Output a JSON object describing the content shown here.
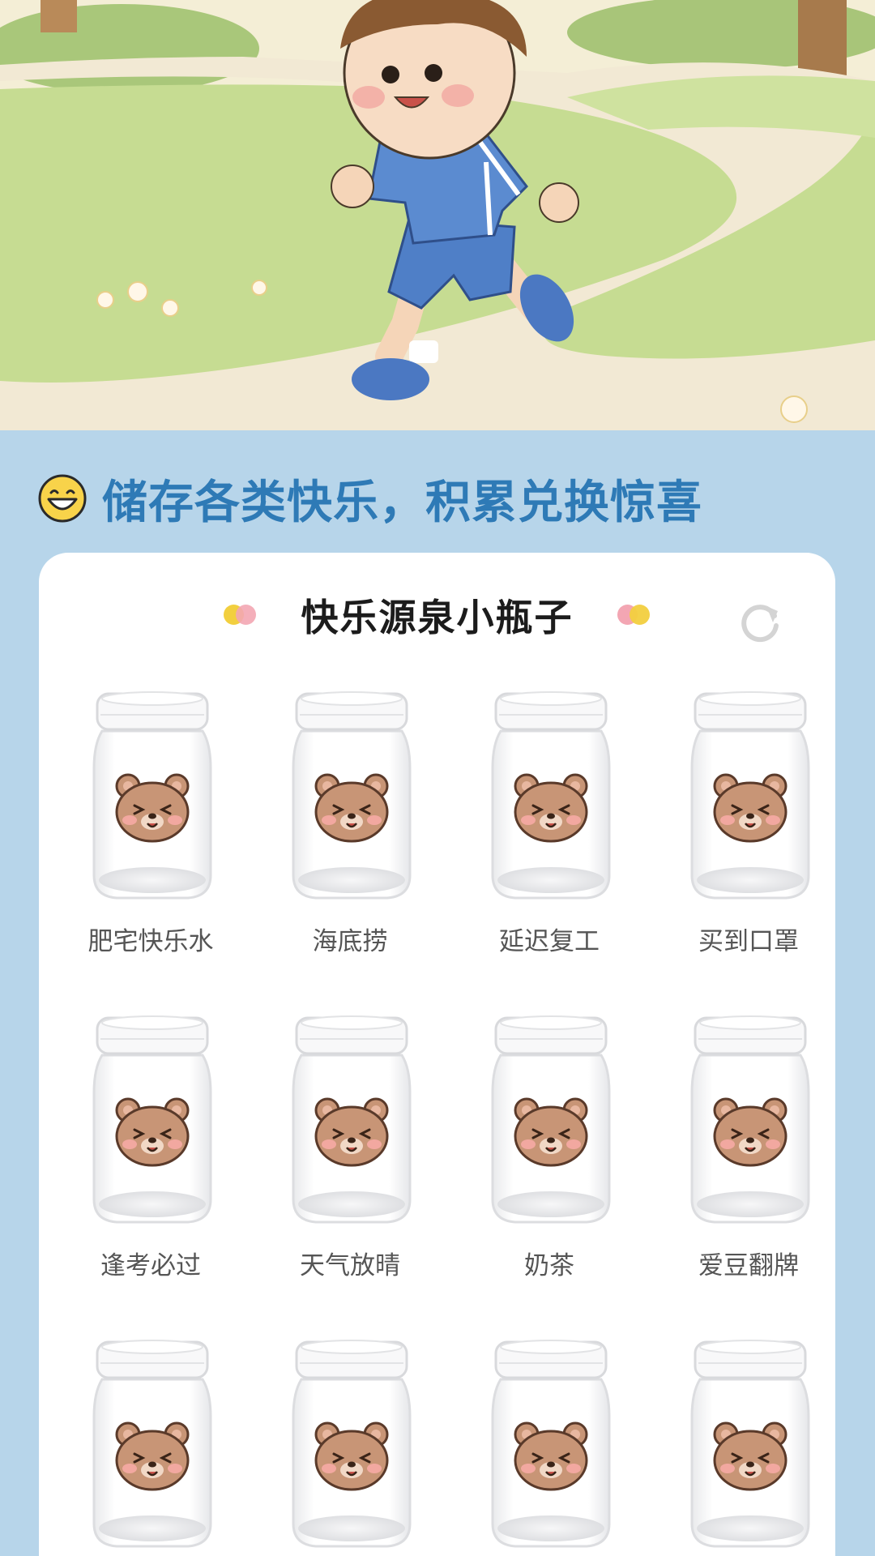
{
  "headline": {
    "icon": "grinning-face-icon",
    "text": "储存各类快乐，积累兑换惊喜"
  },
  "card": {
    "title": "快乐源泉小瓶子",
    "refresh_icon": "refresh-icon",
    "decor_colors": {
      "yellow": "#f2cf3f",
      "pink": "#f3a6b3"
    }
  },
  "jars": [
    {
      "label": "肥宅快乐水",
      "icon": "bear-face-icon"
    },
    {
      "label": "海底捞",
      "icon": "bear-face-icon"
    },
    {
      "label": "延迟复工",
      "icon": "bear-face-icon"
    },
    {
      "label": "买到口罩",
      "icon": "bear-face-icon"
    },
    {
      "label": "逢考必过",
      "icon": "bear-face-icon"
    },
    {
      "label": "天气放晴",
      "icon": "bear-face-icon"
    },
    {
      "label": "奶茶",
      "icon": "bear-face-icon"
    },
    {
      "label": "爱豆翻牌",
      "icon": "bear-face-icon"
    },
    {
      "label": "",
      "icon": "bear-face-icon"
    },
    {
      "label": "",
      "icon": "bear-face-icon"
    },
    {
      "label": "",
      "icon": "bear-face-icon"
    },
    {
      "label": "",
      "icon": "bear-face-icon"
    }
  ],
  "colors": {
    "background": "#b7d5ea",
    "accent": "#2e7ab6"
  }
}
